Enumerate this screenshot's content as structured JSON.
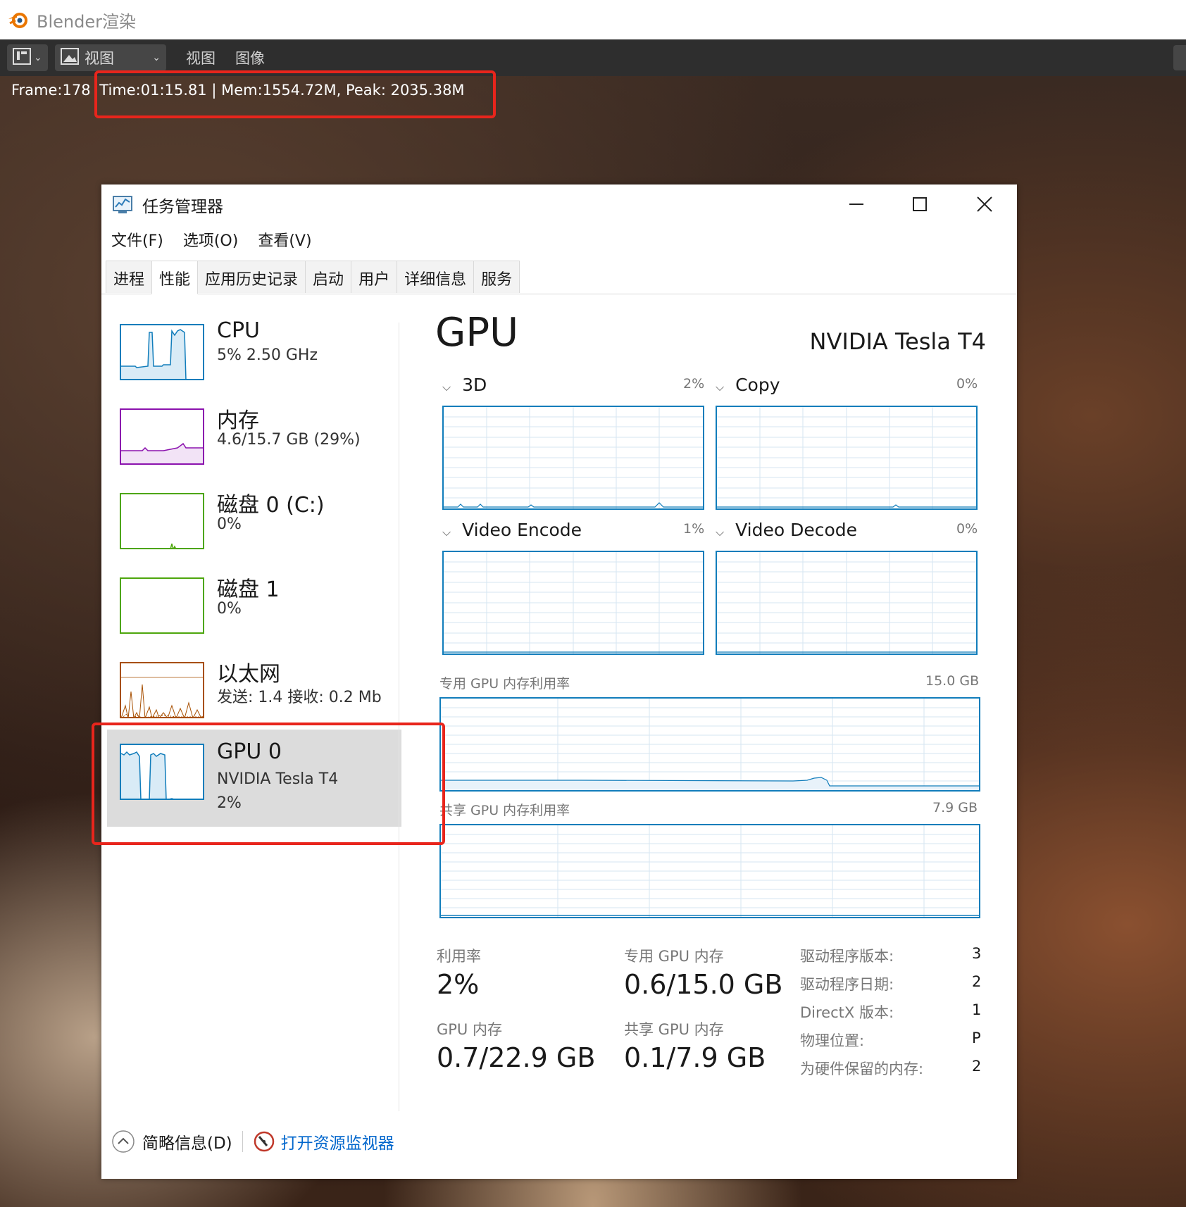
{
  "blender": {
    "title": "Blender渲染",
    "toolbar": {
      "view_dropdown": "视图",
      "menu_view": "视图",
      "menu_image": "图像"
    },
    "status": {
      "frame": "Frame:178",
      "stats": "Time:01:15.81 | Mem:1554.72M, Peak: 2035.38M"
    }
  },
  "taskmanager": {
    "title": "任务管理器",
    "menus": [
      "文件(F)",
      "选项(O)",
      "查看(V)"
    ],
    "tabs": [
      "进程",
      "性能",
      "应用历史记录",
      "启动",
      "用户",
      "详细信息",
      "服务"
    ],
    "active_tab": "性能",
    "sidebar": [
      {
        "name": "CPU",
        "sub1": "5%  2.50 GHz",
        "color": "#117dbb"
      },
      {
        "name": "内存",
        "sub1": "4.6/15.7 GB (29%)",
        "color": "#8b12ae"
      },
      {
        "name": "磁盘 0 (C:)",
        "sub1": "0%",
        "color": "#4da60c"
      },
      {
        "name": "磁盘 1",
        "sub1": "0%",
        "color": "#4da60c"
      },
      {
        "name": "以太网",
        "sub1": "发送: 1.4  接收: 0.2 Mb",
        "color": "#a74f01"
      },
      {
        "name": "GPU 0",
        "sub1": "NVIDIA Tesla T4",
        "sub2": "2%",
        "color": "#117dbb",
        "selected": true
      }
    ],
    "gpu": {
      "heading": "GPU",
      "model": "NVIDIA Tesla T4",
      "engines": [
        {
          "name": "3D",
          "pct": "2%"
        },
        {
          "name": "Copy",
          "pct": "0%"
        },
        {
          "name": "Video Encode",
          "pct": "1%"
        },
        {
          "name": "Video Decode",
          "pct": "0%"
        }
      ],
      "dedicated_caption": "专用 GPU 内存利用率",
      "dedicated_max": "15.0 GB",
      "shared_caption": "共享 GPU 内存利用率",
      "shared_max": "7.9 GB",
      "stats": {
        "util_label": "利用率",
        "util_value": "2%",
        "ded_label": "专用 GPU 内存",
        "ded_value": "0.6/15.0 GB",
        "gpumem_label": "GPU 内存",
        "gpumem_value": "0.7/22.9 GB",
        "shared_label": "共享 GPU 内存",
        "shared_value": "0.1/7.9 GB"
      },
      "info": [
        {
          "label": "驱动程序版本:",
          "value": "3"
        },
        {
          "label": "驱动程序日期:",
          "value": "2"
        },
        {
          "label": "DirectX 版本:",
          "value": "1"
        },
        {
          "label": "物理位置:",
          "value": "P"
        },
        {
          "label": "为硬件保留的内存:",
          "value": "2"
        }
      ]
    },
    "footer": {
      "summary": "简略信息(D)",
      "resource_monitor": "打开资源监视器"
    }
  },
  "colors": {
    "highlight": "#e8251c",
    "graph_blue": "#117dbb",
    "link": "#0066cc"
  }
}
